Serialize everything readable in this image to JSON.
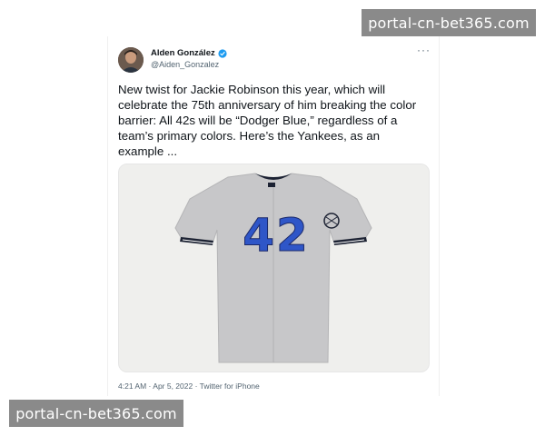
{
  "watermark": {
    "top_text": "portal-cn-bet365.com",
    "bottom_text": "portal-cn-bet365.com"
  },
  "tweet": {
    "author_name": "Alden González",
    "author_handle": "@Aiden_Gonzalez",
    "more_label": "···",
    "text": "New twist for Jackie Robinson this year, which will celebrate the 75th anniversary of him breaking the color barrier: All 42s will be “Dodger Blue,” regardless of a team’s primary colors. Here’s the Yankees, as an example ...",
    "media": {
      "jersey_number": "42",
      "jersey_color": "#c7c7c9",
      "number_color": "#2f56c8",
      "trim_color": "#1c2233"
    },
    "timestamp": "4:21 AM · Apr 5, 2022 · Twitter for iPhone"
  },
  "colors": {
    "verified": "#1d9bf0",
    "secondary_text": "#536471"
  }
}
